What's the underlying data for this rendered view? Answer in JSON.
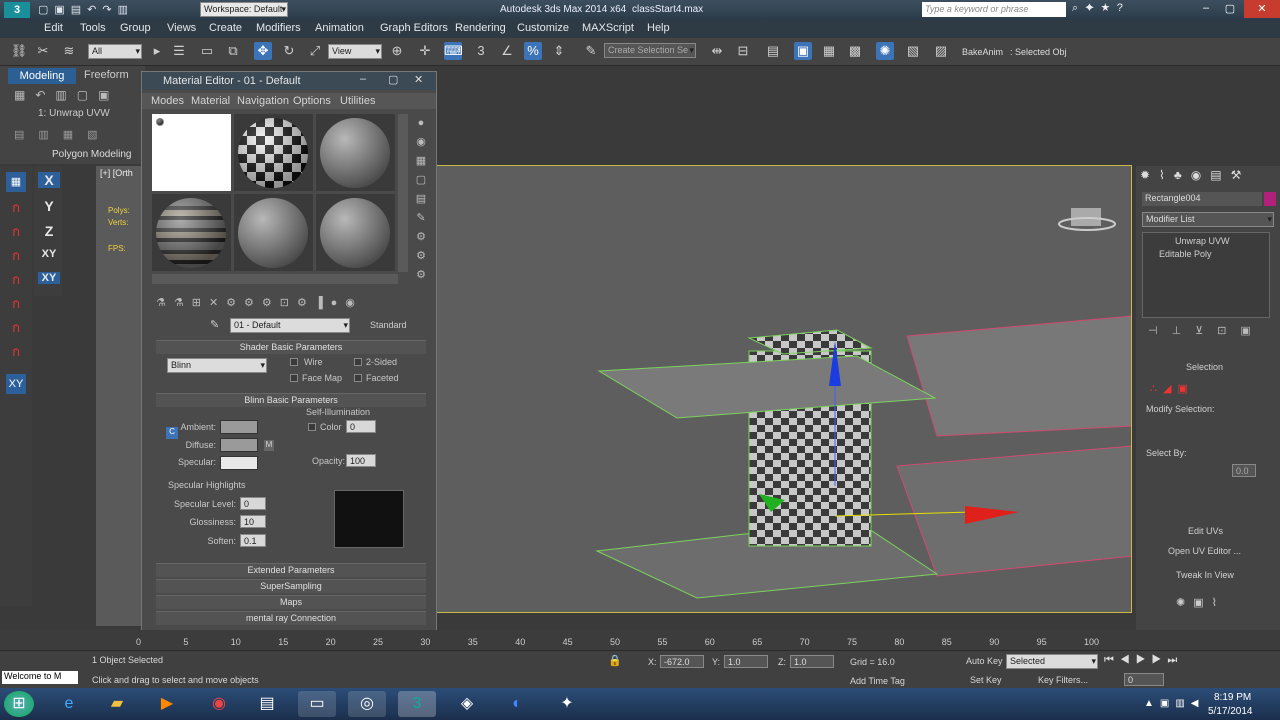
{
  "title_bar": {
    "workspace": "Workspace: Default",
    "app_title": "Autodesk 3ds Max 2014 x64",
    "file_name": "classStart4.max",
    "search_placeholder": "Type a keyword or phrase"
  },
  "menu": [
    "Edit",
    "Tools",
    "Group",
    "Views",
    "Create",
    "Modifiers",
    "Animation",
    "Graph Editors",
    "Rendering",
    "Customize",
    "MAXScript",
    "Help"
  ],
  "toolbar": {
    "filter": "All",
    "ref_coord": "View",
    "selection_set": "Create Selection Se",
    "bake_label": "BakeAnim",
    "selected_obj": ": Selected Obj"
  },
  "ribbon": {
    "tabs": [
      "Modeling",
      "Freeform"
    ],
    "stack_item": "1: Unwrap UVW",
    "panel": "Polygon Modeling"
  },
  "viewport": {
    "label": "[+] [Orth",
    "stats": [
      "Polys:",
      "Verts:",
      "FPS:"
    ]
  },
  "axis_constraints": [
    "X",
    "Y",
    "Z",
    "XY",
    "XY"
  ],
  "material_editor": {
    "title": "Material Editor - 01 - Default",
    "menu": [
      "Modes",
      "Material",
      "Navigation",
      "Options",
      "Utilities"
    ],
    "material_name": "01 - Default",
    "material_type": "Standard",
    "shader_rollout": "Shader Basic Parameters",
    "shader": "Blinn",
    "wire": "Wire",
    "two_sided": "2-Sided",
    "face_map": "Face Map",
    "faceted": "Faceted",
    "blinn_rollout": "Blinn Basic Parameters",
    "self_illum": "Self-Illumination",
    "ambient": "Ambient:",
    "diffuse": "Diffuse:",
    "specular": "Specular:",
    "color": "Color",
    "color_val": "0",
    "opacity": "Opacity:",
    "opacity_val": "100",
    "spec_highlights": "Specular Highlights",
    "spec_level": "Specular Level:",
    "spec_level_val": "0",
    "glossiness": "Glossiness:",
    "glossiness_val": "10",
    "soften": "Soften:",
    "soften_val": "0.1",
    "m": "M",
    "rollouts": [
      "Extended Parameters",
      "SuperSampling",
      "Maps",
      "mental ray Connection"
    ]
  },
  "command_panel": {
    "object_name": "Rectangle004",
    "modifier_list": "Modifier List",
    "stack": [
      "Unwrap UVW",
      "Editable Poly"
    ],
    "selection": "Selection",
    "modify_selection": "Modify Selection:",
    "select_by": "Select By:",
    "select_val": "0.0",
    "edit_uvs": "Edit UVs",
    "open_uv": "Open UV Editor ...",
    "tweak": "Tweak In View"
  },
  "timeline": {
    "ticks": [
      "0",
      "5",
      "10",
      "15",
      "20",
      "25",
      "30",
      "35",
      "40",
      "45",
      "50",
      "55",
      "60",
      "65",
      "70",
      "75",
      "80",
      "85",
      "90",
      "95",
      "100"
    ]
  },
  "status": {
    "welcome": "Welcome to M",
    "selected": "1 Object Selected",
    "prompt": "Click and drag to select and move objects",
    "x_label": "X:",
    "x_val": "-672.0",
    "y_label": "Y:",
    "y_val": "1.0",
    "z_label": "Z:",
    "z_val": "1.0",
    "grid": "Grid = 16.0",
    "add_time_tag": "Add Time Tag",
    "auto_key": "Auto Key",
    "set_key": "Set Key",
    "key_sel": "Selected",
    "key_filters": "Key Filters...",
    "frame": "0"
  },
  "taskbar": {
    "time": "8:19 PM",
    "date": "5/17/2014"
  }
}
